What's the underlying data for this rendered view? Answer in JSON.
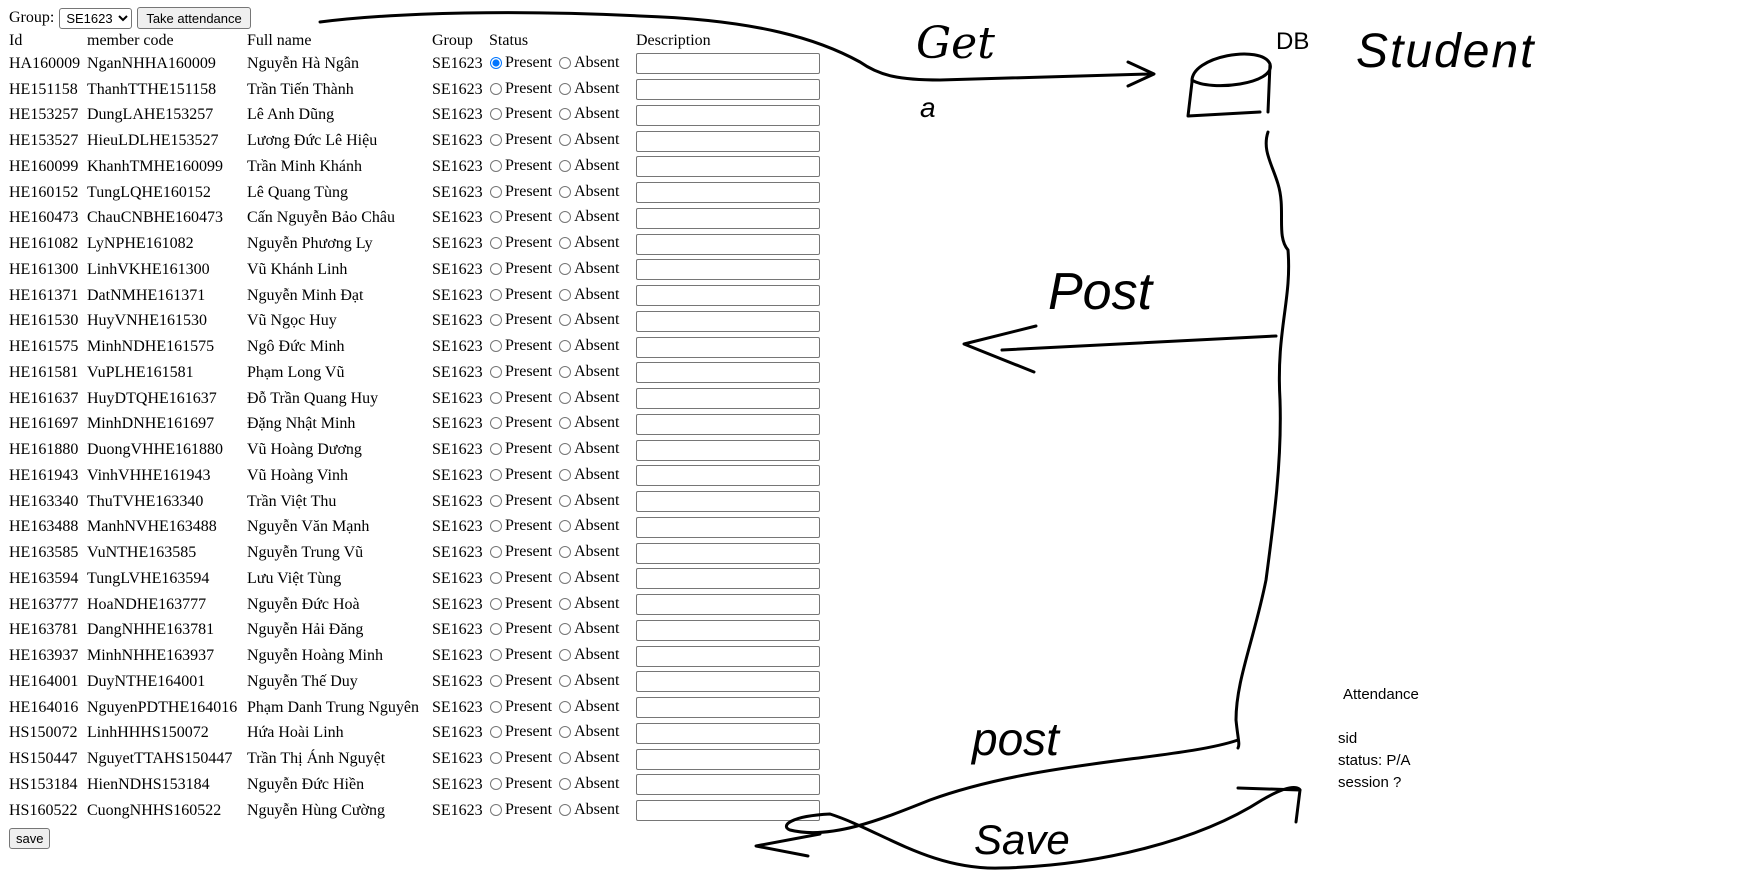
{
  "toolbar": {
    "group_label": "Group:",
    "group_selected": "SE1623",
    "take_attendance_label": "Take attendance"
  },
  "table": {
    "headers": {
      "id": "Id",
      "member_code": "member code",
      "full_name": "Full name",
      "group": "Group",
      "status": "Status",
      "description": "Description"
    },
    "present_label": "Present",
    "absent_label": "Absent",
    "rows": [
      {
        "id": "HA160009",
        "code": "NganNHHA160009",
        "name": "Nguyễn Hà Ngân",
        "group": "SE1623",
        "status": "present",
        "description": ""
      },
      {
        "id": "HE151158",
        "code": "ThanhTTHE151158",
        "name": "Trần Tiến Thành",
        "group": "SE1623",
        "status": "",
        "description": ""
      },
      {
        "id": "HE153257",
        "code": "DungLAHE153257",
        "name": "Lê Anh Dũng",
        "group": "SE1623",
        "status": "",
        "description": ""
      },
      {
        "id": "HE153527",
        "code": "HieuLDLHE153527",
        "name": "Lương Đức Lê Hiệu",
        "group": "SE1623",
        "status": "",
        "description": ""
      },
      {
        "id": "HE160099",
        "code": "KhanhTMHE160099",
        "name": "Trần Minh Khánh",
        "group": "SE1623",
        "status": "",
        "description": ""
      },
      {
        "id": "HE160152",
        "code": "TungLQHE160152",
        "name": "Lê Quang Tùng",
        "group": "SE1623",
        "status": "",
        "description": ""
      },
      {
        "id": "HE160473",
        "code": "ChauCNBHE160473",
        "name": "Cấn Nguyễn Bảo Châu",
        "group": "SE1623",
        "status": "",
        "description": ""
      },
      {
        "id": "HE161082",
        "code": "LyNPHE161082",
        "name": "Nguyễn Phương Ly",
        "group": "SE1623",
        "status": "",
        "description": ""
      },
      {
        "id": "HE161300",
        "code": "LinhVKHE161300",
        "name": "Vũ Khánh Linh",
        "group": "SE1623",
        "status": "",
        "description": ""
      },
      {
        "id": "HE161371",
        "code": "DatNMHE161371",
        "name": "Nguyễn Minh Đạt",
        "group": "SE1623",
        "status": "",
        "description": ""
      },
      {
        "id": "HE161530",
        "code": "HuyVNHE161530",
        "name": "Vũ Ngọc Huy",
        "group": "SE1623",
        "status": "",
        "description": ""
      },
      {
        "id": "HE161575",
        "code": "MinhNDHE161575",
        "name": "Ngô Đức Minh",
        "group": "SE1623",
        "status": "",
        "description": ""
      },
      {
        "id": "HE161581",
        "code": "VuPLHE161581",
        "name": "Phạm Long Vũ",
        "group": "SE1623",
        "status": "",
        "description": ""
      },
      {
        "id": "HE161637",
        "code": "HuyDTQHE161637",
        "name": "Đỗ Trần Quang Huy",
        "group": "SE1623",
        "status": "",
        "description": ""
      },
      {
        "id": "HE161697",
        "code": "MinhDNHE161697",
        "name": "Đặng Nhật Minh",
        "group": "SE1623",
        "status": "",
        "description": ""
      },
      {
        "id": "HE161880",
        "code": "DuongVHHE161880",
        "name": "Vũ Hoàng Dương",
        "group": "SE1623",
        "status": "",
        "description": ""
      },
      {
        "id": "HE161943",
        "code": "VinhVHHE161943",
        "name": "Vũ Hoàng Vinh",
        "group": "SE1623",
        "status": "",
        "description": ""
      },
      {
        "id": "HE163340",
        "code": "ThuTVHE163340",
        "name": "Trần Việt Thu",
        "group": "SE1623",
        "status": "",
        "description": ""
      },
      {
        "id": "HE163488",
        "code": "ManhNVHE163488",
        "name": "Nguyễn Văn Mạnh",
        "group": "SE1623",
        "status": "",
        "description": ""
      },
      {
        "id": "HE163585",
        "code": "VuNTHE163585",
        "name": "Nguyễn Trung Vũ",
        "group": "SE1623",
        "status": "",
        "description": ""
      },
      {
        "id": "HE163594",
        "code": "TungLVHE163594",
        "name": "Lưu Việt Tùng",
        "group": "SE1623",
        "status": "",
        "description": ""
      },
      {
        "id": "HE163777",
        "code": "HoaNDHE163777",
        "name": "Nguyễn Đức Hoà",
        "group": "SE1623",
        "status": "",
        "description": ""
      },
      {
        "id": "HE163781",
        "code": "DangNHHE163781",
        "name": "Nguyễn Hải Đăng",
        "group": "SE1623",
        "status": "",
        "description": ""
      },
      {
        "id": "HE163937",
        "code": "MinhNHHE163937",
        "name": "Nguyễn Hoàng Minh",
        "group": "SE1623",
        "status": "",
        "description": ""
      },
      {
        "id": "HE164001",
        "code": "DuyNTHE164001",
        "name": "Nguyễn Thế Duy",
        "group": "SE1623",
        "status": "",
        "description": ""
      },
      {
        "id": "HE164016",
        "code": "NguyenPDTHE164016",
        "name": "Phạm Danh Trung Nguyên",
        "group": "SE1623",
        "status": "",
        "description": ""
      },
      {
        "id": "HS150072",
        "code": "LinhHHHS150072",
        "name": "Hứa Hoài Linh",
        "group": "SE1623",
        "status": "",
        "description": ""
      },
      {
        "id": "HS150447",
        "code": "NguyetTTAHS150447",
        "name": "Trần Thị Ánh Nguyệt",
        "group": "SE1623",
        "status": "",
        "description": ""
      },
      {
        "id": "HS153184",
        "code": "HienNDHS153184",
        "name": "Nguyễn Đức Hiền",
        "group": "SE1623",
        "status": "",
        "description": ""
      },
      {
        "id": "HS160522",
        "code": "CuongNHHS160522",
        "name": "Nguyễn Hùng Cường",
        "group": "SE1623",
        "status": "",
        "description": ""
      }
    ]
  },
  "save_label": "save",
  "sketch": {
    "labels": [
      "Get",
      "a",
      "DB",
      "Student",
      "Post",
      "post",
      "Save"
    ]
  },
  "notes": {
    "title": "Attendance",
    "lines": [
      "sid",
      "status: P/A",
      "session ?"
    ]
  }
}
